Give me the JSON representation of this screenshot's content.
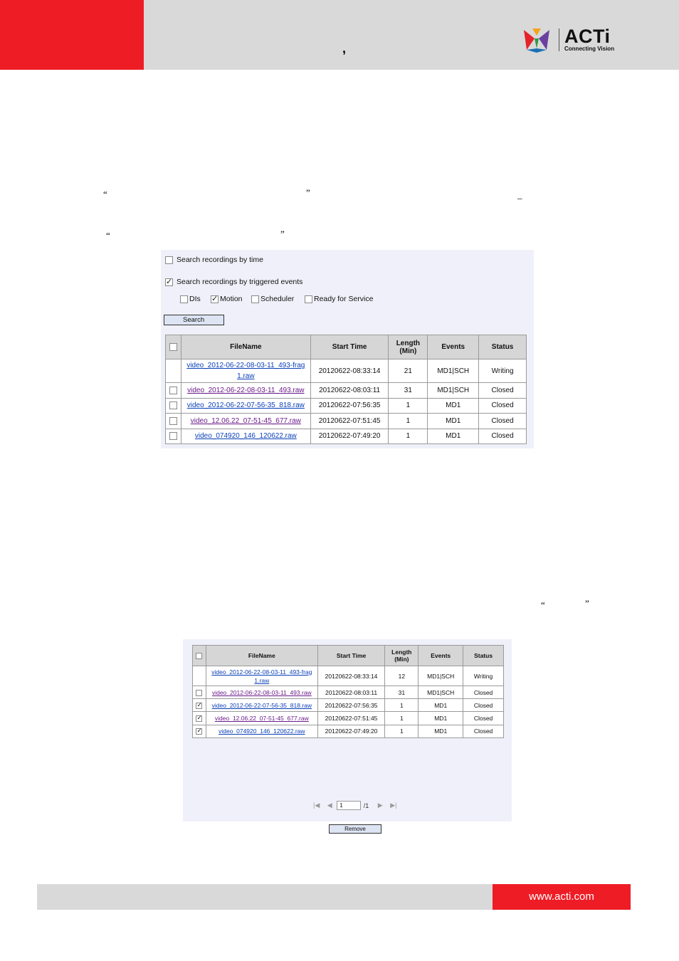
{
  "header": {
    "comma": ",",
    "logo": {
      "name": "ACTi",
      "tagline": "Connecting Vision"
    }
  },
  "quotes": {
    "q1_open": "“",
    "q1_close": "”",
    "dash": "_",
    "q2_open": "“",
    "q2_close": "”",
    "q3_open": "“",
    "q3_close": "”"
  },
  "search_panel": {
    "by_time_label": "Search recordings by time",
    "by_time_checked": false,
    "by_events_label": "Search recordings by triggered events",
    "by_events_checked": true,
    "event_options": [
      {
        "label": "DIs",
        "checked": false
      },
      {
        "label": "Motion",
        "checked": true
      },
      {
        "label": "Scheduler",
        "checked": false
      },
      {
        "label": "Ready for Service",
        "checked": false
      }
    ],
    "search_button": "Search"
  },
  "table1": {
    "columns": [
      "FileName",
      "Start Time",
      "Length (Min)",
      "Events",
      "Status"
    ],
    "rows": [
      {
        "file": "video_2012-06-22-08-03-11_493-frag 1.raw",
        "file_line1": "video_2012-06-22-08-03-11_493-frag",
        "file_line2": "1.raw",
        "start": "20120622-08:33:14",
        "length": "21",
        "events": "MD1|SCH",
        "status": "Writing",
        "has_checkbox": false,
        "checked": false
      },
      {
        "file": "video_2012-06-22-08-03-11_493.raw",
        "start": "20120622-08:03:11",
        "length": "31",
        "events": "MD1|SCH",
        "status": "Closed",
        "has_checkbox": true,
        "checked": false
      },
      {
        "file": "video_2012-06-22-07-56-35_818.raw",
        "start": "20120622-07:56:35",
        "length": "1",
        "events": "MD1",
        "status": "Closed",
        "has_checkbox": true,
        "checked": false
      },
      {
        "file": "video_12.06.22_07-51-45_677.raw",
        "start": "20120622-07:51:45",
        "length": "1",
        "events": "MD1",
        "status": "Closed",
        "has_checkbox": true,
        "checked": false
      },
      {
        "file": "video_074920_146_120622.raw",
        "start": "20120622-07:49:20",
        "length": "1",
        "events": "MD1",
        "status": "Closed",
        "has_checkbox": true,
        "checked": false
      }
    ]
  },
  "table2": {
    "columns": [
      "FileName",
      "Start Time",
      "Length (Min)",
      "Events",
      "Status"
    ],
    "rows": [
      {
        "file": "video_2012-06-22-08-03-11_493-frag 1.raw",
        "file_line1": "video_2012-06-22-08-03-11_493-frag",
        "file_line2": "1.raw",
        "start": "20120622-08:33:14",
        "length": "12",
        "events": "MD1|SCH",
        "status": "Writing",
        "has_checkbox": false,
        "checked": false
      },
      {
        "file": "video_2012-06-22-08-03-11_493.raw",
        "start": "20120622-08:03:11",
        "length": "31",
        "events": "MD1|SCH",
        "status": "Closed",
        "has_checkbox": true,
        "checked": false
      },
      {
        "file": "video_2012-06-22-07-56-35_818.raw",
        "start": "20120622-07:56:35",
        "length": "1",
        "events": "MD1",
        "status": "Closed",
        "has_checkbox": true,
        "checked": true
      },
      {
        "file": "video_12.06.22_07-51-45_677.raw",
        "start": "20120622-07:51:45",
        "length": "1",
        "events": "MD1",
        "status": "Closed",
        "has_checkbox": true,
        "checked": true
      },
      {
        "file": "video_074920_146_120622.raw",
        "start": "20120622-07:49:20",
        "length": "1",
        "events": "MD1",
        "status": "Closed",
        "has_checkbox": true,
        "checked": true
      }
    ],
    "pager": {
      "current_page": "1",
      "total": "/1"
    },
    "remove_button": "Remove"
  },
  "footer": {
    "url": "www.acti.com"
  },
  "colors": {
    "brand_red": "#ee1c25",
    "header_gray": "#d9d9d9",
    "panel_bg": "#f0f0fa",
    "link_blue": "#0a3fb8",
    "link_visited": "#6a1a8a"
  }
}
